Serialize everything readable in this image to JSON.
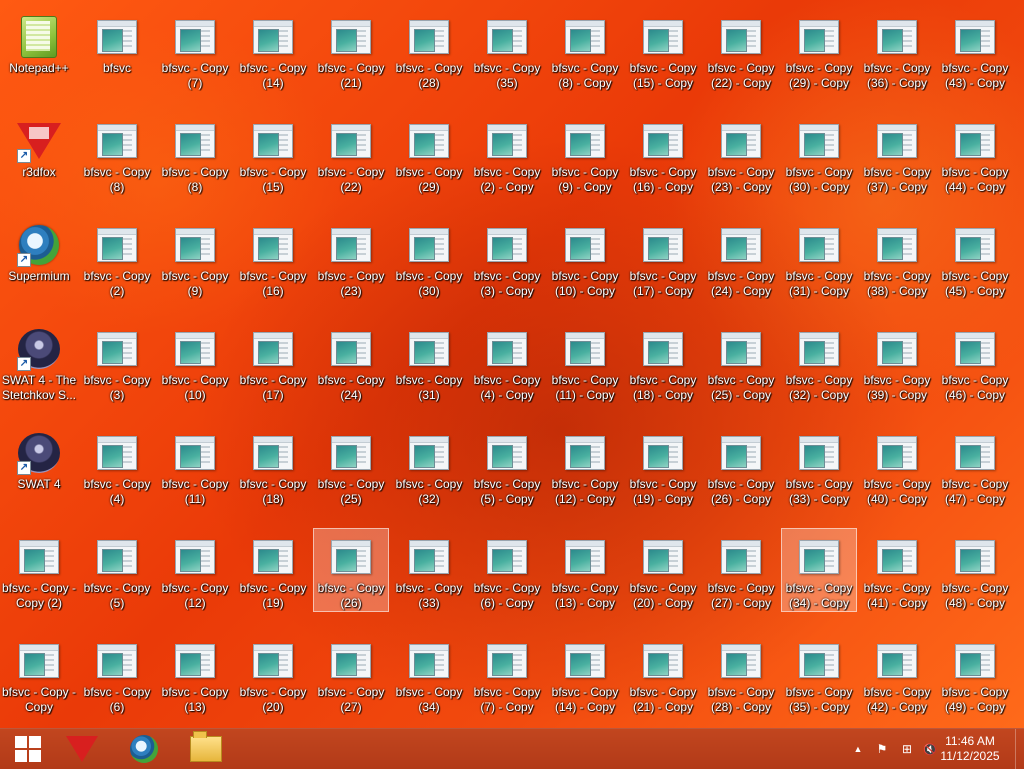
{
  "desktop": {
    "special_icons": [
      {
        "label": "Notepad++",
        "icon": "notepad-plus-plus-icon",
        "shortcut": false
      },
      {
        "label": "r3dfox",
        "icon": "r3dfox-icon",
        "shortcut": true
      },
      {
        "label": "Supermium",
        "icon": "supermium-icon",
        "shortcut": true
      },
      {
        "label": "SWAT 4 - The Stetchkov S...",
        "icon": "swat4-stetchkov-icon",
        "shortcut": true
      },
      {
        "label": "SWAT 4",
        "icon": "swat4-icon",
        "shortcut": true
      }
    ],
    "file_labels": [
      [
        "bfsvc",
        "bfsvc - Copy (8)",
        "bfsvc - Copy (2)",
        "bfsvc - Copy (3)",
        "bfsvc - Copy (4)",
        "bfsvc - Copy (5)",
        "bfsvc - Copy (6)"
      ],
      [
        "bfsvc - Copy (7)",
        "bfsvc - Copy (8)",
        "bfsvc - Copy (9)",
        "bfsvc - Copy (10)",
        "bfsvc - Copy (11)",
        "bfsvc - Copy (12)",
        "bfsvc - Copy (13)"
      ],
      [
        "bfsvc - Copy (14)",
        "bfsvc - Copy (15)",
        "bfsvc - Copy (16)",
        "bfsvc - Copy (17)",
        "bfsvc - Copy (18)",
        "bfsvc - Copy (19)",
        "bfsvc - Copy (20)"
      ],
      [
        "bfsvc - Copy (21)",
        "bfsvc - Copy (22)",
        "bfsvc - Copy (23)",
        "bfsvc - Copy (24)",
        "bfsvc - Copy (25)",
        "bfsvc - Copy (26)",
        "bfsvc - Copy (27)"
      ],
      [
        "bfsvc - Copy (28)",
        "bfsvc - Copy (29)",
        "bfsvc - Copy (30)",
        "bfsvc - Copy (31)",
        "bfsvc - Copy (32)",
        "bfsvc - Copy (33)",
        "bfsvc - Copy (34)"
      ],
      [
        "bfsvc - Copy (35)",
        "bfsvc - Copy (2) - Copy",
        "bfsvc - Copy (3) - Copy",
        "bfsvc - Copy (4) - Copy",
        "bfsvc - Copy (5) - Copy",
        "bfsvc - Copy (6) - Copy",
        "bfsvc - Copy (7) - Copy"
      ],
      [
        "bfsvc - Copy (8) - Copy",
        "bfsvc - Copy (9) - Copy",
        "bfsvc - Copy (10) - Copy",
        "bfsvc - Copy (11) - Copy",
        "bfsvc - Copy (12) - Copy",
        "bfsvc - Copy (13) - Copy",
        "bfsvc - Copy (14) - Copy"
      ],
      [
        "bfsvc - Copy (15) - Copy",
        "bfsvc - Copy (16) - Copy",
        "bfsvc - Copy (17) - Copy",
        "bfsvc - Copy (18) - Copy",
        "bfsvc - Copy (19) - Copy",
        "bfsvc - Copy (20) - Copy",
        "bfsvc - Copy (21) - Copy"
      ],
      [
        "bfsvc - Copy (22) - Copy",
        "bfsvc - Copy (23) - Copy",
        "bfsvc - Copy (24) - Copy",
        "bfsvc - Copy (25) - Copy",
        "bfsvc - Copy (26) - Copy",
        "bfsvc - Copy (27) - Copy",
        "bfsvc - Copy (28) - Copy"
      ],
      [
        "bfsvc - Copy (29) - Copy",
        "bfsvc - Copy (30) - Copy",
        "bfsvc - Copy (31) - Copy",
        "bfsvc - Copy (32) - Copy",
        "bfsvc - Copy (33) - Copy",
        "bfsvc - Copy (34) - Copy",
        "bfsvc - Copy (35) - Copy"
      ],
      [
        "bfsvc - Copy (36) - Copy",
        "bfsvc - Copy (37) - Copy",
        "bfsvc - Copy (38) - Copy",
        "bfsvc - Copy (39) - Copy",
        "bfsvc - Copy (40) - Copy",
        "bfsvc - Copy (41) - Copy",
        "bfsvc - Copy (42) - Copy"
      ],
      [
        "bfsvc - Copy (43) - Copy",
        "bfsvc - Copy (44) - Copy",
        "bfsvc - Copy (45) - Copy",
        "bfsvc - Copy (46) - Copy",
        "bfsvc - Copy (47) - Copy",
        "bfsvc - Copy (48) - Copy",
        "bfsvc - Copy (49) - Copy"
      ]
    ],
    "extra_first_column_files": [
      "bfsvc - Copy - Copy (2)",
      "bfsvc - Copy - Copy"
    ],
    "selected_labels": [
      "bfsvc - Copy (26)",
      "bfsvc - Copy (34) - Copy"
    ],
    "background_color": "#f04a0e"
  },
  "taskbar": {
    "pinned": [
      {
        "name": "start-button",
        "icon": "windows-logo-icon"
      },
      {
        "name": "taskbar-r3dfox",
        "icon": "r3dfox-icon"
      },
      {
        "name": "taskbar-supermium",
        "icon": "supermium-icon"
      },
      {
        "name": "taskbar-file-explorer",
        "icon": "folder-icon"
      }
    ],
    "tray": {
      "chevron": "▲",
      "flag": "⚑",
      "network": "⊞",
      "volume": "🔇"
    },
    "clock": {
      "time": "11:46 AM",
      "date": "11/12/2025"
    }
  }
}
